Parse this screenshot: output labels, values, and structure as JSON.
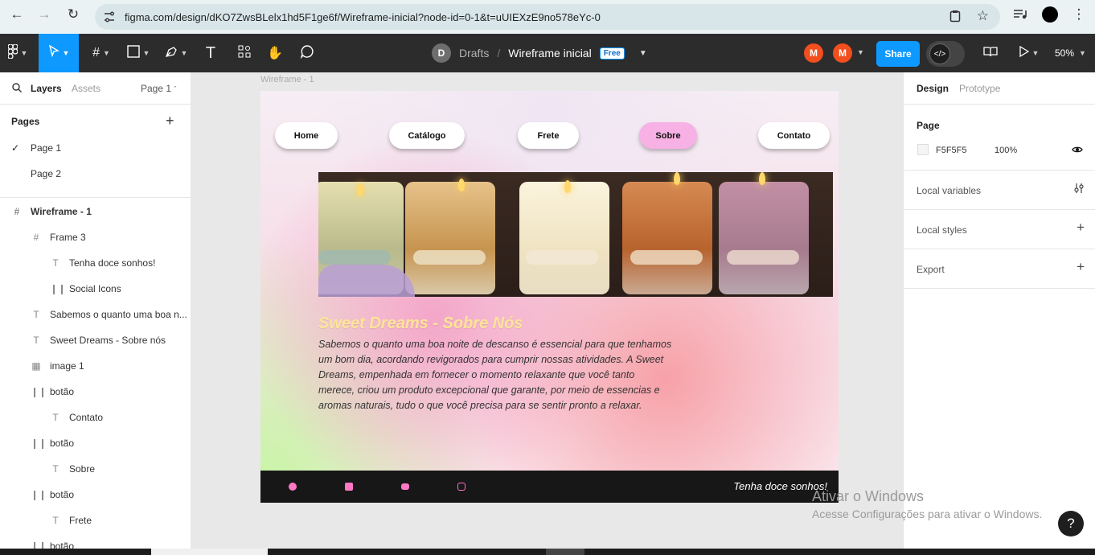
{
  "browser": {
    "url": "figma.com/design/dKO7ZwsBLelx1hd5F1ge6f/Wireframe-inicial?node-id=0-1&t=uUIEXzE9no578eYc-0"
  },
  "toolbar": {
    "avatar_initial": "D",
    "drafts": "Drafts",
    "slash": "/",
    "file_name": "Wireframe inicial",
    "plan_badge": "Free",
    "user1_initial": "M",
    "user2_initial": "M",
    "share_label": "Share",
    "zoom": "50%"
  },
  "left_panel": {
    "tab_layers": "Layers",
    "tab_assets": "Assets",
    "page_selector": "Page 1",
    "pages_header": "Pages",
    "pages": [
      "Page 1",
      "Page 2"
    ],
    "layers": [
      {
        "label": "Wireframe - 1",
        "type": "frame"
      },
      {
        "label": "Frame 3",
        "type": "frame"
      },
      {
        "label": "Tenha doce sonhos!",
        "type": "text"
      },
      {
        "label": "Social Icons",
        "type": "component"
      },
      {
        "label": "Sabemos o quanto uma boa n...",
        "type": "text"
      },
      {
        "label": "Sweet Dreams - Sobre nós",
        "type": "text"
      },
      {
        "label": "image 1",
        "type": "image"
      },
      {
        "label": "botão",
        "type": "component"
      },
      {
        "label": "Contato",
        "type": "text"
      },
      {
        "label": "botão",
        "type": "component"
      },
      {
        "label": "Sobre",
        "type": "text"
      },
      {
        "label": "botão",
        "type": "component"
      },
      {
        "label": "Frete",
        "type": "text"
      },
      {
        "label": "botão",
        "type": "component"
      }
    ]
  },
  "canvas": {
    "frame_label": "Wireframe - 1",
    "nav": [
      "Home",
      "Catálogo",
      "Frete",
      "Sobre",
      "Contato"
    ],
    "active_nav": "Sobre",
    "heading": "Sweet Dreams - Sobre Nós",
    "paragraph": " Sabemos o quanto uma boa noite de descanso é essencial para que tenhamos um bom dia, acordando revigorados para cumprir nossas atividades. A Sweet Dreams, empenhada em fornecer o momento relaxante que você tanto merece, criou um produto excepcional que garante, por meio de essencias e aromas naturais, tudo o que você precisa para se sentir pronto a relaxar.",
    "footer_text": "Tenha doce sonhos!",
    "social_icons": [
      "facebook-icon",
      "linkedin-icon",
      "youtube-icon",
      "instagram-icon"
    ],
    "colors": {
      "heading": "#fde49a",
      "active_nav": "#f7b1e4",
      "footer_bg": "#171717",
      "social": "#ff78c6"
    }
  },
  "right_panel": {
    "tab_design": "Design",
    "tab_prototype": "Prototype",
    "page_header": "Page",
    "bg_hex": "F5F5F5",
    "bg_opacity": "100%",
    "local_variables": "Local variables",
    "local_styles": "Local styles",
    "export": "Export"
  },
  "watermark": {
    "line1": "Ativar o Windows",
    "line2": "Acesse Configurações para ativar o Windows."
  },
  "help_label": "?"
}
